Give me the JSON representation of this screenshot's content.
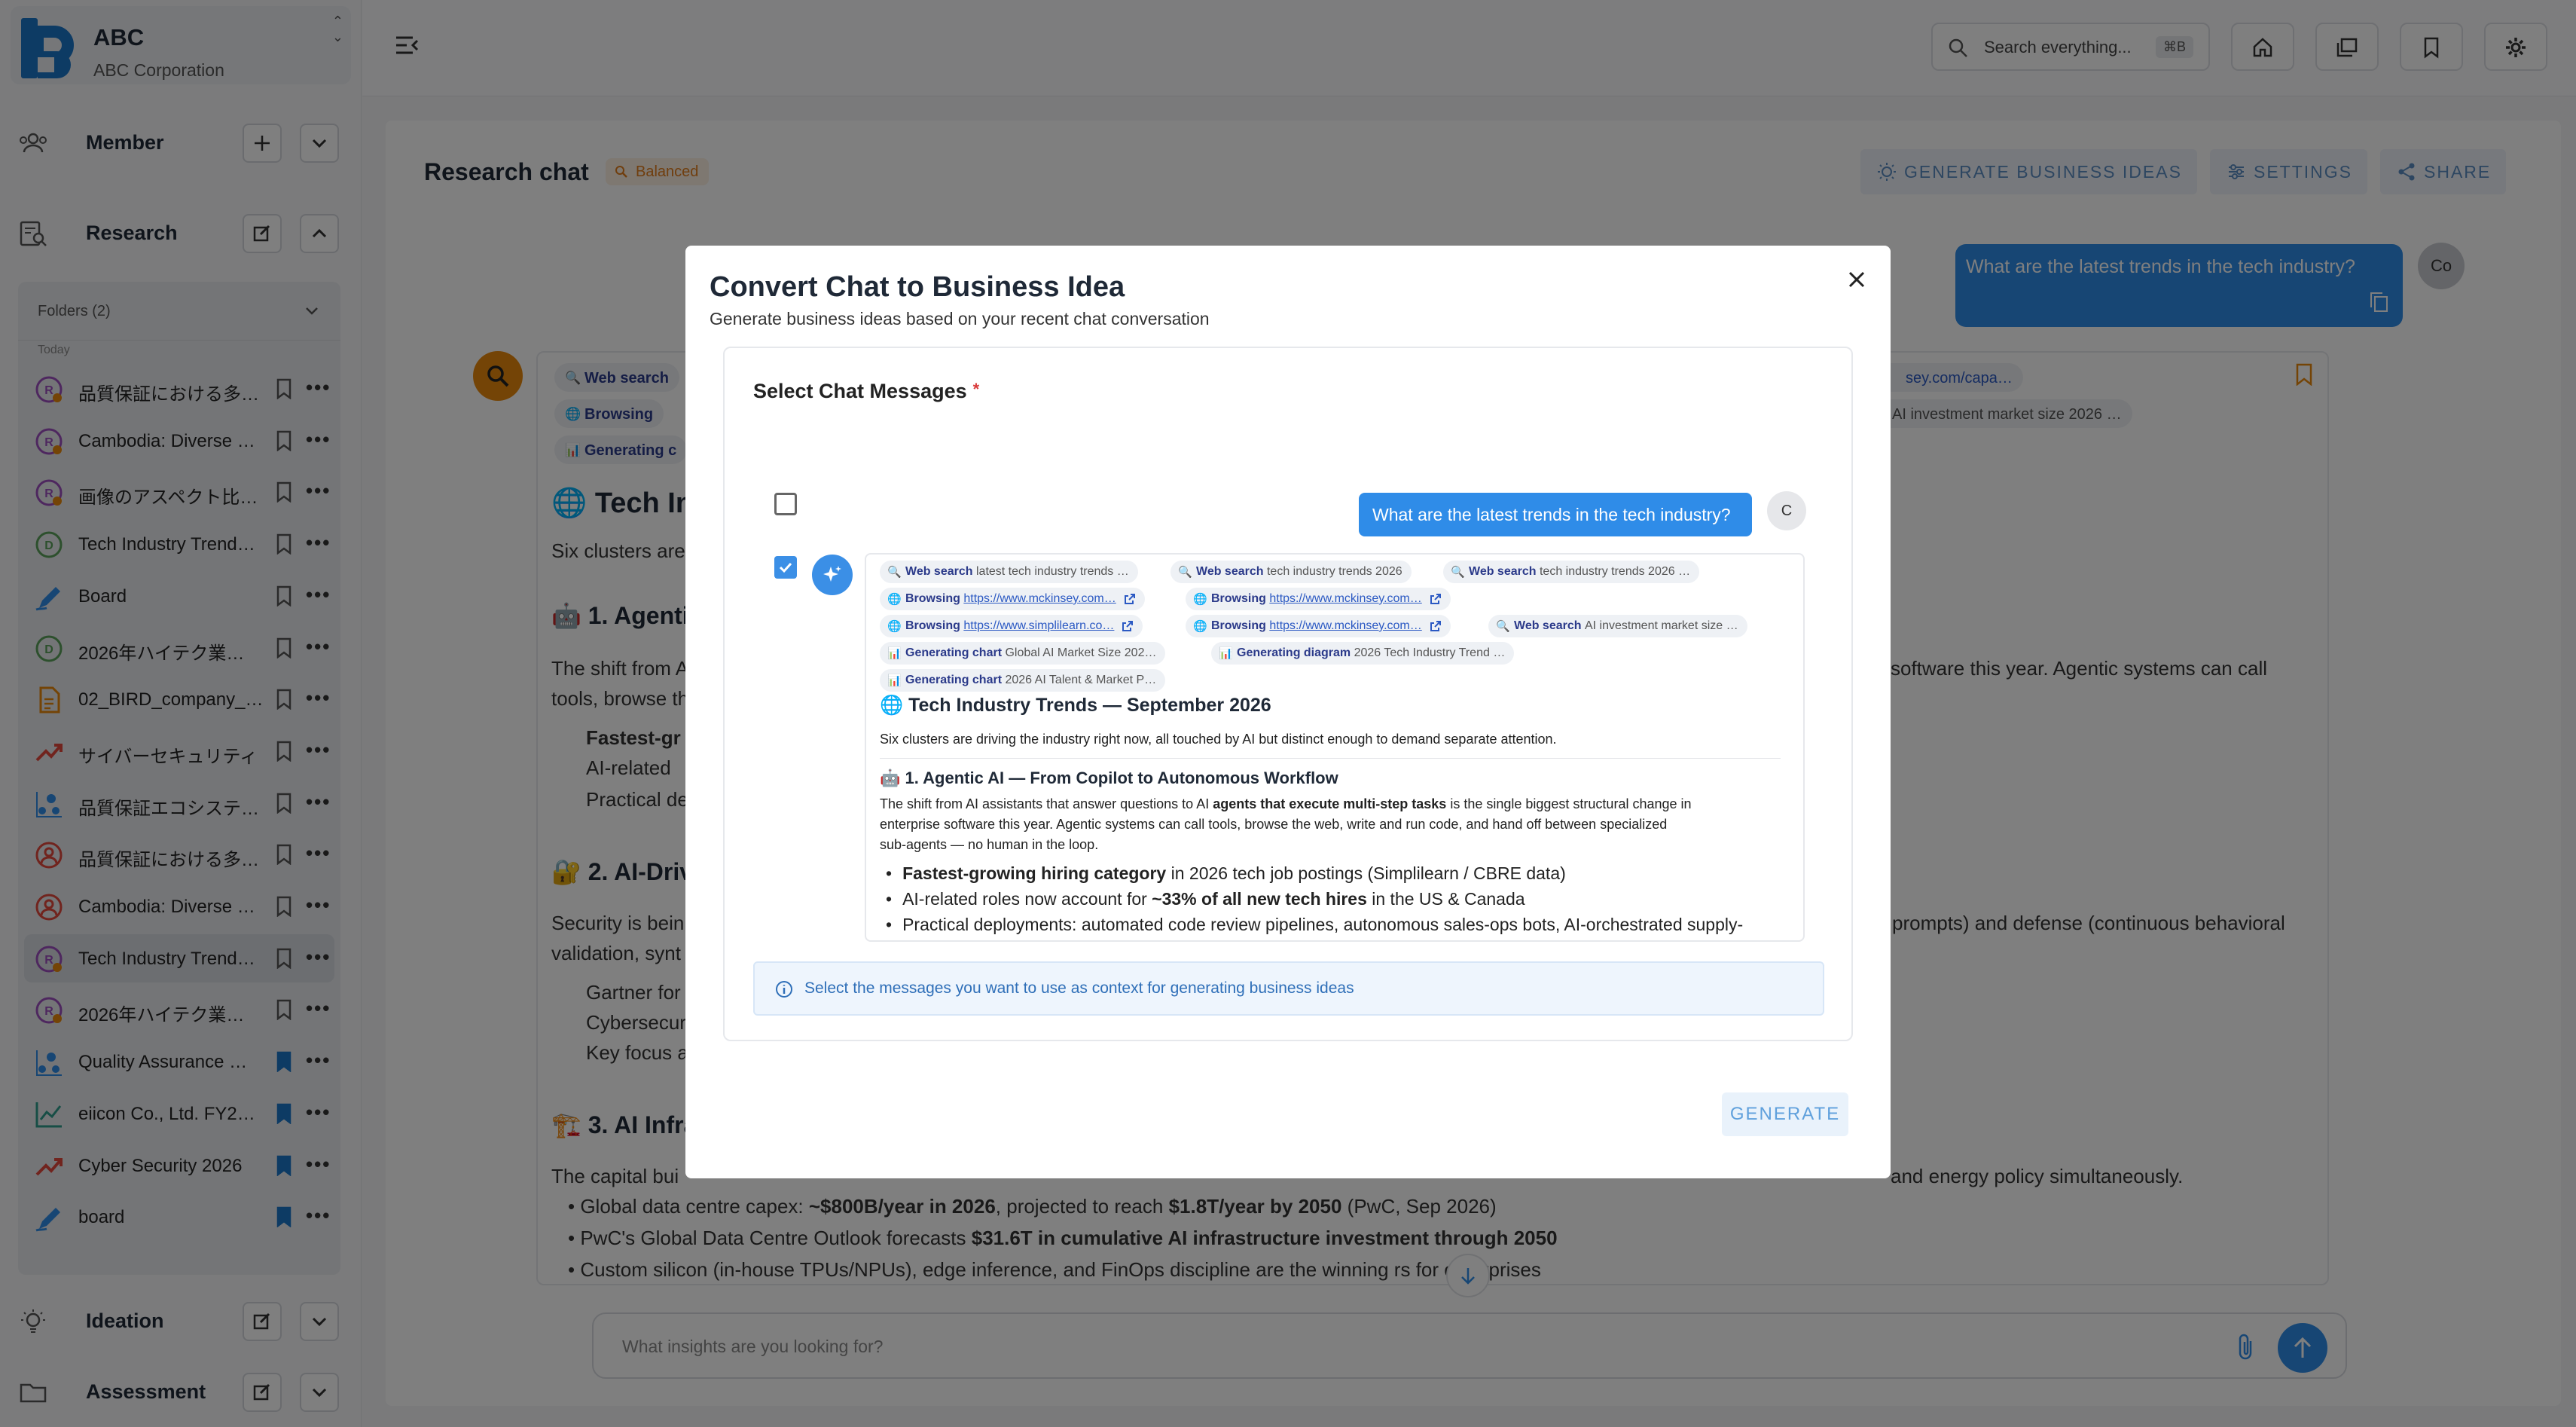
{
  "org": {
    "name": "ABC",
    "subtitle": "ABC Corporation"
  },
  "sections": {
    "member": "Member",
    "research": "Research",
    "ideation": "Ideation",
    "assessment": "Assessment"
  },
  "folders_label": "Folders (2)",
  "group_label": "Today",
  "chats": [
    {
      "title": "品質保証における多…",
      "icon": "research-chat-icon",
      "color": "#9c4fbf",
      "bookmarked": false
    },
    {
      "title": "Cambodia: Diverse …",
      "icon": "research-chat-icon",
      "color": "#9c4fbf",
      "bookmarked": false
    },
    {
      "title": "画像のアスペクト比…",
      "icon": "research-chat-icon",
      "color": "#9c4fbf",
      "bookmarked": false
    },
    {
      "title": "Tech Industry Trend…",
      "icon": "document-chat-icon",
      "color": "#5aa05a",
      "bookmarked": false
    },
    {
      "title": "Board",
      "icon": "pen-icon",
      "color": "#2f8ce8",
      "bookmarked": false
    },
    {
      "title": "2026年ハイテク業…",
      "icon": "document-chat-icon",
      "color": "#5aa05a",
      "bookmarked": false
    },
    {
      "title": "02_BIRD_company_…",
      "icon": "file-icon",
      "color": "#e8890c",
      "bookmarked": false
    },
    {
      "title": "サイバーセキュリティ",
      "icon": "trend-icon",
      "color": "#e2483d",
      "bookmarked": false
    },
    {
      "title": "品質保証エコシステ…",
      "icon": "scatter-icon",
      "color": "#2f8ce8",
      "bookmarked": false
    },
    {
      "title": "品質保証における多…",
      "icon": "user-circle-icon",
      "color": "#e2483d",
      "bookmarked": false
    },
    {
      "title": "Cambodia: Diverse …",
      "icon": "user-circle-icon",
      "color": "#e2483d",
      "bookmarked": false
    },
    {
      "title": "Tech Industry Trend…",
      "icon": "research-chat-icon",
      "color": "#9c4fbf",
      "bookmarked": false,
      "selected": true
    },
    {
      "title": "2026年ハイテク業…",
      "icon": "research-chat-icon",
      "color": "#9c4fbf",
      "bookmarked": false
    },
    {
      "title": "Quality Assurance …",
      "icon": "scatter-icon",
      "color": "#2f8ce8",
      "bookmarked": true
    },
    {
      "title": "eiicon Co., Ltd. FY2…",
      "icon": "line-chart-icon",
      "color": "#2f9c8c",
      "bookmarked": true
    },
    {
      "title": "Cyber Security 2026",
      "icon": "trend-icon",
      "color": "#e2483d",
      "bookmarked": true
    },
    {
      "title": "board",
      "icon": "pen-icon",
      "color": "#2f8ce8",
      "bookmarked": true
    }
  ],
  "search": {
    "placeholder": "Search everything...",
    "shortcut": "⌘B"
  },
  "colors": {
    "accent": "#2f8ce8",
    "orange": "#e8890c",
    "brand": "#1b76c9"
  },
  "research": {
    "title": "Research chat",
    "mode": "Balanced",
    "buttons": {
      "ideas": "GENERATE BUSINESS IDEAS",
      "settings": "SETTINGS",
      "share": "SHARE"
    },
    "user_message": "What are the latest trends in the tech industry?",
    "user_avatar": "Co",
    "bg_chips": [
      {
        "icon": "🔍",
        "label": "Web search"
      },
      {
        "icon": "🌐",
        "label": "Browsing"
      },
      {
        "icon": "📊",
        "label": "Generating c"
      }
    ],
    "bg_chips_right": [
      {
        "text": "sey.com/capa…"
      },
      {
        "text": "AI investment market size 2026 …"
      }
    ],
    "bg_heading": "🌐 Tech Ind",
    "bg_intro": "Six clusters are",
    "bg_h1": "🤖 1. Agentic",
    "bg_p1a": "The shift from A",
    "bg_p1b": "tools, browse th",
    "bg_p1_right": "software this year. Agentic systems can call",
    "bg_b1": [
      "Fastest-gr",
      "AI-related",
      "Practical de"
    ],
    "bg_h2": "🔐 2. AI-Driv",
    "bg_p2a": "Security is bein",
    "bg_p2b": "validation, synt",
    "bg_p2_right": "prompts) and defense (continuous behavioral",
    "bg_b2": [
      "Gartner for",
      "Cybersecur",
      "Key focus a"
    ],
    "bg_h3": "🏗️ 3. AI Infra",
    "bg_p3": "The capital bui",
    "bg_p3_right": "and energy policy simultaneously.",
    "bg_b3": [
      {
        "pre": "Global data centre capex: ",
        "bold": "~$800B/year in 2026",
        "mid": ", projected to reach ",
        "bold2": "$1.8T/year by 2050",
        "post": " (PwC, Sep 2026)"
      },
      {
        "pre": "PwC's Global Data Centre Outlook forecasts ",
        "bold": "$31.6T in cumulative AI infrastructure investment through 2050",
        "mid": "",
        "bold2": "",
        "post": ""
      },
      {
        "pre": "Custom silicon (in-house TPUs/NPUs), edge inference, and FinOps discipline are the winning r",
        "bold": "",
        "mid": "",
        "bold2": "",
        "post": "s for enterprises"
      }
    ],
    "input_placeholder": "What insights are you looking for?"
  },
  "modal": {
    "title": "Convert Chat to Business Idea",
    "subtitle": "Generate business ideas based on your recent chat conversation",
    "select_label": "Select Chat Messages",
    "required_mark": "*",
    "user_message": "What are the latest trends in the tech industry?",
    "user_avatar": "C",
    "user_checked": false,
    "bot_checked": true,
    "chips": [
      {
        "icon": "🔍",
        "label": "Web search",
        "text": "latest tech industry trends …",
        "type": "query",
        "link": false
      },
      {
        "icon": "🔍",
        "label": "Web search",
        "text": "tech industry trends 2026",
        "type": "query",
        "link": false
      },
      {
        "icon": "🔍",
        "label": "Web search",
        "text": "tech industry trends 2026 …",
        "type": "query",
        "link": false
      },
      {
        "icon": "🌐",
        "label": "Browsing",
        "text": "https://www.mckinsey.com…",
        "type": "url",
        "link": true
      },
      {
        "icon": "🌐",
        "label": "Browsing",
        "text": "https://www.mckinsey.com…",
        "type": "url",
        "link": true
      },
      {
        "icon": "🌐",
        "label": "Browsing",
        "text": "https://www.simplilearn.co…",
        "type": "url",
        "link": true
      },
      {
        "icon": "🌐",
        "label": "Browsing",
        "text": "https://www.mckinsey.com…",
        "type": "url",
        "link": true
      },
      {
        "icon": "🔍",
        "label": "Web search",
        "text": "AI investment market size …",
        "type": "query",
        "link": false
      },
      {
        "icon": "📊",
        "label": "Generating chart",
        "text": "Global AI Market Size 202…",
        "type": "query",
        "link": false
      },
      {
        "icon": "📊",
        "label": "Generating diagram",
        "text": "2026 Tech Industry Trend …",
        "type": "query",
        "link": false
      },
      {
        "icon": "📊",
        "label": "Generating chart",
        "text": "2026 AI Talent & Market P…",
        "type": "query",
        "link": false
      }
    ],
    "heading": "🌐 Tech Industry Trends — September 2026",
    "intro": "Six clusters are driving the industry right now, all touched by AI but distinct enough to demand separate attention.",
    "h1": "🤖 1. Agentic AI — From Copilot to Autonomous Workflow",
    "p1_pre": "The shift from AI assistants that answer questions to AI ",
    "p1_bold": "agents that execute multi-step tasks",
    "p1_post": " is the single biggest structural change in",
    "p1_line2": "enterprise software this year. Agentic systems can call tools, browse the web, write and run code, and hand off between specialized",
    "p1_line3": "sub-agents — no human in the loop.",
    "bullets": [
      {
        "bold": "Fastest-growing hiring category",
        "post": " in 2026 tech job postings (Simplilearn / CBRE data)",
        "pre": ""
      },
      {
        "pre": "AI-related roles now account for ",
        "bold": "~33% of all new tech hires",
        "post": " in the US & Canada"
      },
      {
        "pre": "Practical deployments: automated code review pipelines, autonomous sales-ops bots, AI-orchestrated supply-",
        "bold": "",
        "post": ""
      }
    ],
    "info": "Select the messages you want to use as context for generating business ideas",
    "generate": "GENERATE"
  }
}
